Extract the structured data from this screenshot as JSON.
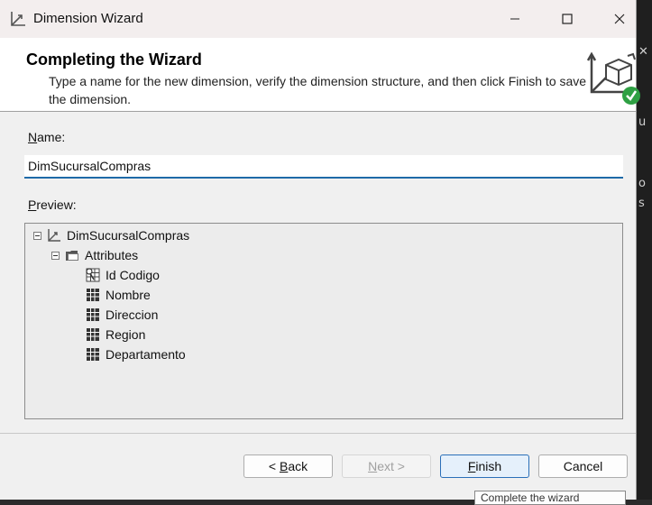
{
  "window": {
    "title": "Dimension Wizard",
    "icon": "dimension-icon",
    "controls": [
      "minimize-icon",
      "maximize-icon",
      "close-icon"
    ]
  },
  "header": {
    "title": "Completing the Wizard",
    "description": "Type a name for the new dimension, verify the dimension structure, and then click Finish to save the dimension.",
    "icon": "dimension-complete-icon"
  },
  "name_field": {
    "label_prefix": "",
    "label_access_key": "N",
    "label_rest": "ame:",
    "value": "DimSucursalCompras"
  },
  "preview": {
    "label_access_key": "P",
    "label_rest": "review:",
    "root": {
      "label": "DimSucursalCompras",
      "icon": "dimension-icon",
      "expanded": true
    },
    "folder": {
      "label": "Attributes",
      "icon": "folder-icon",
      "expanded": true
    },
    "attributes": [
      {
        "label": "Id Codigo",
        "icon": "key-attribute-icon"
      },
      {
        "label": "Nombre",
        "icon": "attribute-icon"
      },
      {
        "label": "Direccion",
        "icon": "attribute-icon"
      },
      {
        "label": "Region",
        "icon": "attribute-icon"
      },
      {
        "label": "Departamento",
        "icon": "attribute-icon"
      }
    ]
  },
  "buttons": {
    "back_prefix": "< ",
    "back_key": "B",
    "back_rest": "ack",
    "next_key": "N",
    "next_rest": "ext >",
    "finish_key": "F",
    "finish_rest": "inish",
    "cancel": "Cancel"
  },
  "tooltip": {
    "text": "Complete the wizard"
  },
  "background_glyphs": [
    "u",
    "o",
    "s"
  ],
  "colors": {
    "accent": "#1e6aa8",
    "success": "#2ea043",
    "titlebar": "#f3eeee"
  }
}
